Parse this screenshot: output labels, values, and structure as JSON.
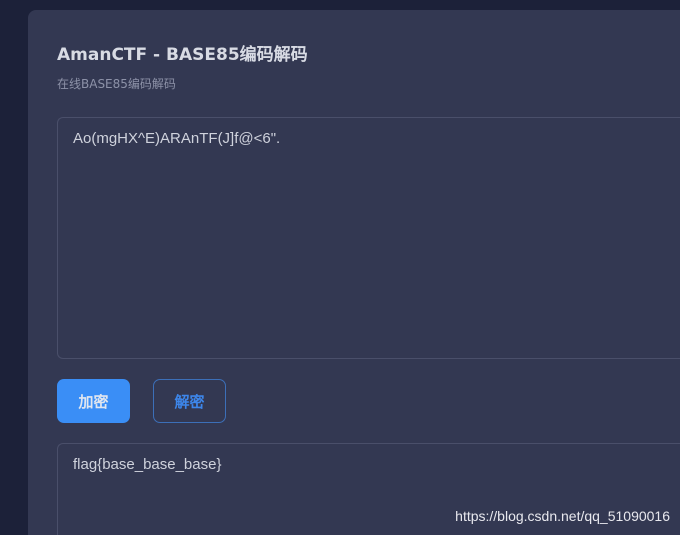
{
  "header": {
    "title": "AmanCTF - BASE85编码解码",
    "subtitle": "在线BASE85编码解码"
  },
  "input": {
    "value": "Ao(mgHX^E)ARAnTF(J]f@<6\"."
  },
  "buttons": {
    "encode": "加密",
    "decode": "解密"
  },
  "output": {
    "value": "flag{base_base_base}"
  },
  "watermark": "https://blog.csdn.net/qq_51090016",
  "colors": {
    "accent": "#3a8ef6",
    "panel": "#333852",
    "background": "#1c2139"
  }
}
